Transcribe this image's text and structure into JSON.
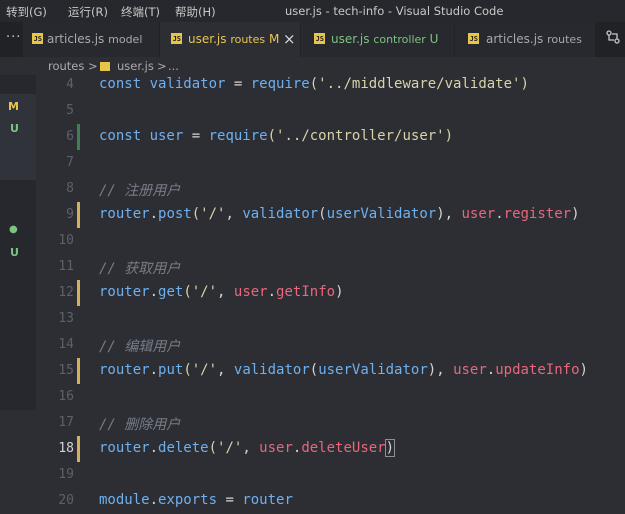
{
  "menu": [
    "转到(G)",
    "运行(R)",
    "终端(T)",
    "帮助(H)"
  ],
  "window_title": "user.js - tech-info - Visual Studio Code",
  "tabs": [
    {
      "name": "articles.js",
      "desc": "model",
      "badge": ""
    },
    {
      "name": "user.js",
      "desc": "routes",
      "badge": "M"
    },
    {
      "name": "user.js",
      "desc": "controller",
      "badge": "U"
    },
    {
      "name": "articles.js",
      "desc": "routes",
      "badge": ""
    }
  ],
  "tab_icon_text": "JS",
  "more_glyph": "···",
  "close_glyph": "×",
  "breadcrumb": {
    "folder": "routes",
    "sep": ">",
    "file": "user.js",
    "more": "..."
  },
  "gutter_marks": [
    "M",
    "U",
    "●",
    "U"
  ],
  "colors": {
    "keyword": "#6fb0ef",
    "string": "#d8d3a8",
    "variable": "#e8677b",
    "comment": "#777c87",
    "modified_bar": "#d5b05c",
    "added_bar": "#3f7f55",
    "accent": "#e6c653"
  },
  "lines": [
    {
      "n": "4",
      "tokens": [
        {
          "t": "const ",
          "c": "kw"
        },
        {
          "t": "validator",
          "c": "def"
        },
        {
          "t": " = ",
          "c": "plain"
        },
        {
          "t": "require",
          "c": "fn"
        },
        {
          "t": "('../middleware/validate')",
          "c": "str"
        }
      ]
    },
    {
      "n": "5",
      "tokens": []
    },
    {
      "n": "6",
      "tokens": [
        {
          "t": "const ",
          "c": "kw"
        },
        {
          "t": "user",
          "c": "def"
        },
        {
          "t": " = ",
          "c": "plain"
        },
        {
          "t": "require",
          "c": "fn"
        },
        {
          "t": "('../controller/user')",
          "c": "str"
        }
      ]
    },
    {
      "n": "7",
      "tokens": []
    },
    {
      "n": "8",
      "tokens": [
        {
          "t": "// 注册用户",
          "c": "cm"
        }
      ]
    },
    {
      "n": "9",
      "tokens": [
        {
          "t": "router",
          "c": "kw"
        },
        {
          "t": ".",
          "c": "plain"
        },
        {
          "t": "post",
          "c": "fn"
        },
        {
          "t": "('/'",
          "c": "str"
        },
        {
          "t": ", ",
          "c": "plain"
        },
        {
          "t": "validator",
          "c": "fn"
        },
        {
          "t": "(",
          "c": "plain"
        },
        {
          "t": "userValidator",
          "c": "kw"
        },
        {
          "t": "), ",
          "c": "plain"
        },
        {
          "t": "user",
          "c": "var"
        },
        {
          "t": ".",
          "c": "plain"
        },
        {
          "t": "register",
          "c": "var"
        },
        {
          "t": ")",
          "c": "plain"
        }
      ]
    },
    {
      "n": "10",
      "tokens": []
    },
    {
      "n": "11",
      "tokens": [
        {
          "t": "// 获取用户",
          "c": "cm"
        }
      ]
    },
    {
      "n": "12",
      "tokens": [
        {
          "t": "router",
          "c": "kw"
        },
        {
          "t": ".",
          "c": "plain"
        },
        {
          "t": "get",
          "c": "fn"
        },
        {
          "t": "('/'",
          "c": "str"
        },
        {
          "t": ", ",
          "c": "plain"
        },
        {
          "t": "user",
          "c": "var"
        },
        {
          "t": ".",
          "c": "plain"
        },
        {
          "t": "getInfo",
          "c": "var"
        },
        {
          "t": ")",
          "c": "plain"
        }
      ]
    },
    {
      "n": "13",
      "tokens": []
    },
    {
      "n": "14",
      "tokens": [
        {
          "t": "// 编辑用户",
          "c": "cm"
        }
      ]
    },
    {
      "n": "15",
      "tokens": [
        {
          "t": "router",
          "c": "kw"
        },
        {
          "t": ".",
          "c": "plain"
        },
        {
          "t": "put",
          "c": "fn"
        },
        {
          "t": "('/'",
          "c": "str"
        },
        {
          "t": ", ",
          "c": "plain"
        },
        {
          "t": "validator",
          "c": "fn"
        },
        {
          "t": "(",
          "c": "plain"
        },
        {
          "t": "userValidator",
          "c": "kw"
        },
        {
          "t": "), ",
          "c": "plain"
        },
        {
          "t": "user",
          "c": "var"
        },
        {
          "t": ".",
          "c": "plain"
        },
        {
          "t": "updateInfo",
          "c": "var"
        },
        {
          "t": ")",
          "c": "plain"
        }
      ]
    },
    {
      "n": "16",
      "tokens": []
    },
    {
      "n": "17",
      "tokens": [
        {
          "t": "// 删除用户",
          "c": "cm"
        }
      ]
    },
    {
      "n": "18",
      "tokens": [
        {
          "t": "router",
          "c": "kw"
        },
        {
          "t": ".",
          "c": "plain"
        },
        {
          "t": "delete",
          "c": "fn"
        },
        {
          "t": "('/'",
          "c": "str"
        },
        {
          "t": ", ",
          "c": "plain"
        },
        {
          "t": "user",
          "c": "var"
        },
        {
          "t": ".",
          "c": "plain"
        },
        {
          "t": "deleteUser",
          "c": "var"
        },
        {
          "t": ")",
          "c": "plain"
        }
      ]
    },
    {
      "n": "19",
      "tokens": []
    },
    {
      "n": "20",
      "tokens": [
        {
          "t": "module",
          "c": "kw"
        },
        {
          "t": ".",
          "c": "plain"
        },
        {
          "t": "exports",
          "c": "kw"
        },
        {
          "t": " = ",
          "c": "plain"
        },
        {
          "t": "router",
          "c": "kw"
        }
      ]
    }
  ]
}
